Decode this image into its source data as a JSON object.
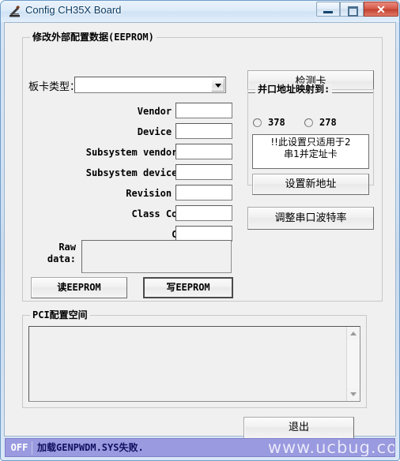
{
  "window": {
    "title": "Config CH35X Board",
    "icon": "app-tool-icon",
    "buttons": {
      "minimize": "minimize-icon",
      "maximize": "maximize-icon",
      "close": "✕"
    }
  },
  "eeprom_group": {
    "title": "修改外部配置数据(EEPROM)",
    "card_type_label": "板卡类型：",
    "card_type_value": "",
    "card_type_placeholder": "",
    "fields": [
      {
        "label": "Vendor ID:",
        "value": ""
      },
      {
        "label": "Device ID:",
        "value": ""
      },
      {
        "label": "Subsystem vendorID:",
        "value": ""
      },
      {
        "label": "Subsystem deviceID:",
        "value": ""
      },
      {
        "label": "Revision ID:",
        "value": ""
      },
      {
        "label": "Class Code:",
        "value": ""
      },
      {
        "label": "CFG:",
        "value": ""
      }
    ],
    "raw_label_line1": "Raw",
    "raw_label_line2": "data:",
    "raw_value": "",
    "read_button": "读EEPROM",
    "write_button": "写EEPROM"
  },
  "right_panel": {
    "detect_button": "检测卡",
    "parport_group": {
      "title": "并口地址映射到:",
      "options": [
        {
          "label": "378",
          "selected": false
        },
        {
          "label": "278",
          "selected": false
        }
      ],
      "warning_line1": "!!此设置只适用于2",
      "warning_line2": "串1并定址卡",
      "set_address_button": "设置新地址"
    },
    "baudrate_button": "调整串口波特率"
  },
  "pci_group": {
    "title": "PCI配置空间",
    "content": "",
    "scrollbar": {
      "up": "scroll-up-icon",
      "down": "scroll-down-icon"
    }
  },
  "exit_button": "退出",
  "statusbar": {
    "state": "OFF",
    "message": "加载GENPWDM.SYS失败.",
    "watermark": "www.ucbug.co"
  },
  "colors": {
    "titlebar_text": "#0b3c64",
    "close_button": "#c23f2d",
    "statusbar_bg": "#9a9ae0",
    "client_bg": "#f0f0f0"
  }
}
